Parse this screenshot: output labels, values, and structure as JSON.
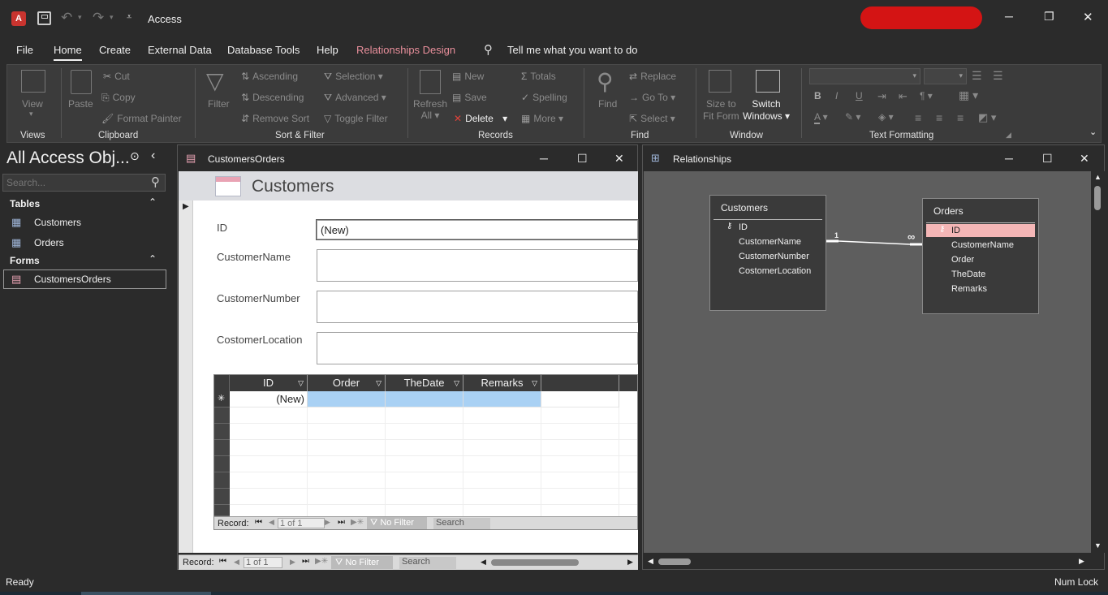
{
  "app": {
    "title": "Access",
    "logo": "A"
  },
  "quick_access": {
    "save_icon": "save-icon",
    "undo_icon": "undo-icon",
    "redo_icon": "redo-icon"
  },
  "window_controls": {
    "minimize": "─",
    "restore": "❐",
    "close": "✕"
  },
  "menu_tabs": [
    {
      "label": "File"
    },
    {
      "label": "Home"
    },
    {
      "label": "Create"
    },
    {
      "label": "External Data"
    },
    {
      "label": "Database Tools"
    },
    {
      "label": "Help"
    },
    {
      "label": "Relationships Design"
    }
  ],
  "tell_me": "Tell me what you want to do",
  "ribbon": {
    "views": {
      "label": "Views",
      "view": "View"
    },
    "clipboard": {
      "label": "Clipboard",
      "paste": "Paste",
      "cut": "Cut",
      "copy": "Copy",
      "format_painter": "Format Painter"
    },
    "sort_filter": {
      "label": "Sort & Filter",
      "filter": "Filter",
      "ascending": "Ascending",
      "descending": "Descending",
      "remove_sort": "Remove Sort",
      "selection": "Selection",
      "advanced": "Advanced",
      "toggle_filter": "Toggle Filter"
    },
    "records": {
      "label": "Records",
      "refresh_1": "Refresh",
      "refresh_2": "All",
      "new": "New",
      "save": "Save",
      "delete": "Delete",
      "totals": "Totals",
      "spelling": "Spelling",
      "more": "More"
    },
    "find": {
      "label": "Find",
      "find": "Find",
      "replace": "Replace",
      "goto": "Go To",
      "select": "Select"
    },
    "window": {
      "label": "Window",
      "size_1": "Size to",
      "size_2": "Fit Form",
      "switch_1": "Switch",
      "switch_2": "Windows"
    },
    "text_formatting": {
      "label": "Text Formatting",
      "bold": "B",
      "italic": "I",
      "underline": "U",
      "font_color": "A"
    }
  },
  "nav_pane": {
    "title": "All Access Obj...",
    "search_placeholder": "Search...",
    "sections": [
      {
        "label": "Tables",
        "items": [
          "Customers",
          "Orders"
        ]
      },
      {
        "label": "Forms",
        "items": [
          "CustomersOrders"
        ]
      }
    ]
  },
  "form_window": {
    "title": "CustomersOrders",
    "header": "Customers",
    "fields": [
      {
        "label": "ID",
        "value": "(New)"
      },
      {
        "label": "CustomerName",
        "value": ""
      },
      {
        "label": "CustomerNumber",
        "value": ""
      },
      {
        "label": "CostomerLocation",
        "value": ""
      }
    ],
    "subform": {
      "columns": [
        "ID",
        "Order",
        "TheDate",
        "Remarks"
      ],
      "new_row_id": "(New)",
      "new_row_marker": "✳",
      "nav": {
        "record_label": "Record:",
        "position": "1 of 1",
        "filter": "No Filter",
        "search": "Search"
      }
    },
    "nav": {
      "record_label": "Record:",
      "position": "1 of 1",
      "filter": "No Filter",
      "search": "Search"
    }
  },
  "relationships_window": {
    "title": "Relationships",
    "tables": [
      {
        "name": "Customers",
        "fields": [
          "ID",
          "CustomerName",
          "CustomerNumber",
          "CostomerLocation"
        ]
      },
      {
        "name": "Orders",
        "fields": [
          "ID",
          "CustomerName",
          "Order",
          "TheDate",
          "Remarks"
        ]
      }
    ],
    "relationship": {
      "one": "1",
      "many": "∞"
    }
  },
  "status": {
    "left": "Ready",
    "right": "Num Lock"
  },
  "colors": {
    "accent_tab": "#e88f9b",
    "selected_field": "#f4b6b6",
    "grid_selected": "#a9d1f4",
    "logo": "#c9342f"
  }
}
